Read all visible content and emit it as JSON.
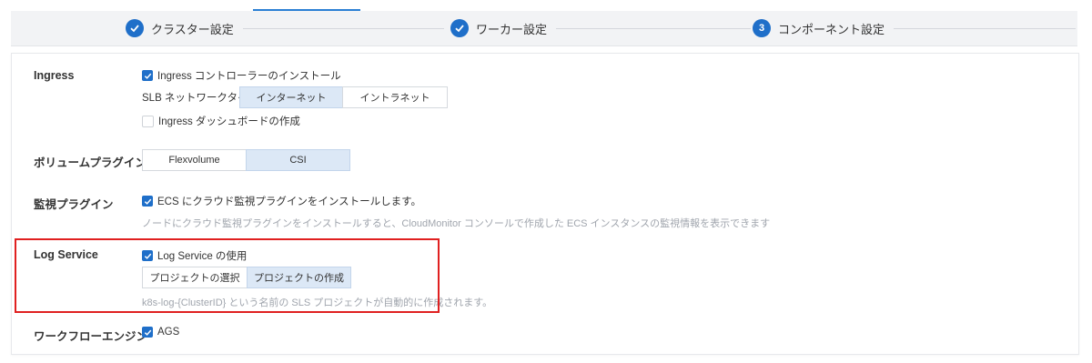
{
  "steps": [
    {
      "label": "クラスター設定",
      "state": "done"
    },
    {
      "label": "ワーカー設定",
      "state": "done"
    },
    {
      "label": "コンポーネント設定",
      "state": "current",
      "number": "3"
    }
  ],
  "ingress": {
    "label": "Ingress",
    "install_label": "Ingress コントローラーのインストール",
    "install_checked": true,
    "slb_label": "SLB ネットワークタイプ",
    "slb_options": [
      "インターネット",
      "イントラネット"
    ],
    "slb_selected": "インターネット",
    "dashboard_label": "Ingress ダッシュボードの作成",
    "dashboard_checked": false
  },
  "volume": {
    "label": "ボリュームプラグイン",
    "options": [
      "Flexvolume",
      "CSI"
    ],
    "selected": "CSI"
  },
  "monitoring": {
    "label": "監視プラグイン",
    "install_label": "ECS にクラウド監視プラグインをインストールします。",
    "install_checked": true,
    "hint": "ノードにクラウド監視プラグインをインストールすると、CloudMonitor コンソールで作成した ECS インスタンスの監視情報を表示できます"
  },
  "log_service": {
    "label": "Log Service",
    "use_label": "Log Service の使用",
    "use_checked": true,
    "options": [
      "プロジェクトの選択",
      "プロジェクトの作成"
    ],
    "selected": "プロジェクトの作成",
    "hint": "k8s-log-{ClusterID} という名前の SLS プロジェクトが自動的に作成されます。"
  },
  "workflow": {
    "label": "ワークフローエンジン",
    "ags_label": "AGS",
    "ags_checked": true
  },
  "colors": {
    "accent": "#1f6fc9",
    "selected_bg": "#dce8f6",
    "highlight_border": "#e02020"
  }
}
